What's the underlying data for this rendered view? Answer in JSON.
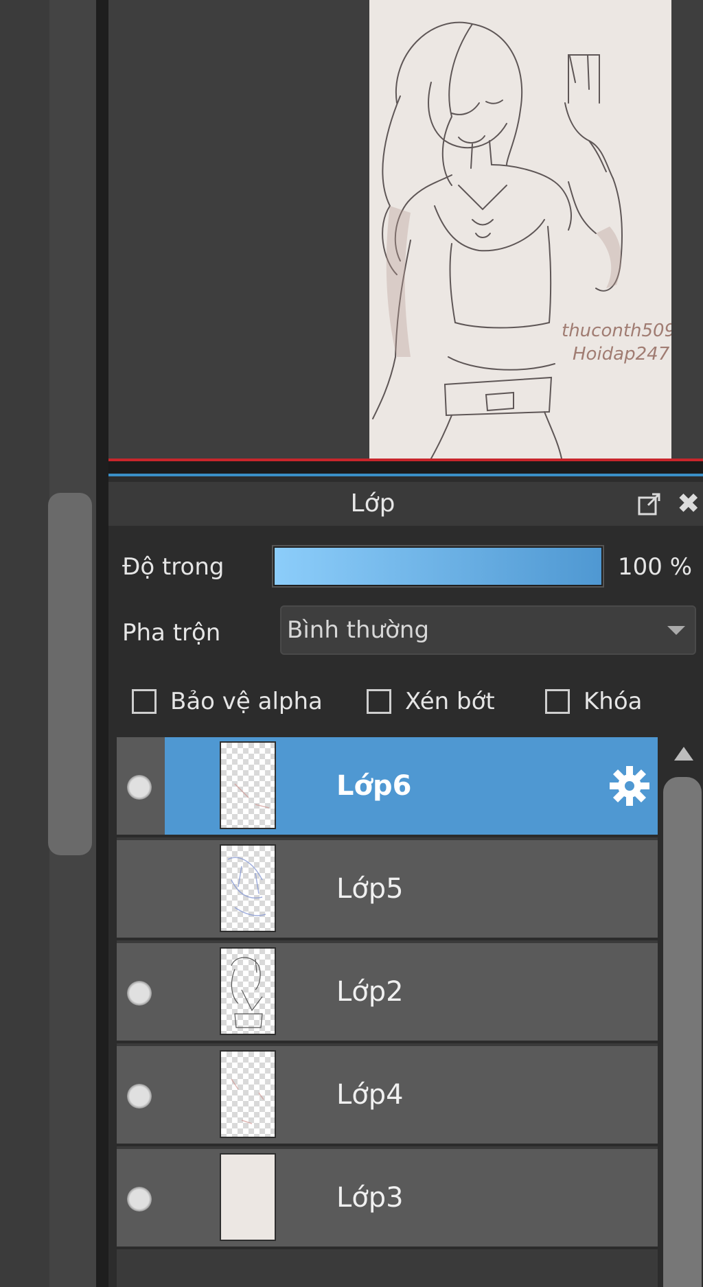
{
  "panel": {
    "title": "Lớp"
  },
  "opacity": {
    "label": "Độ trong",
    "value": 1.0,
    "value_text": "100 %"
  },
  "blend": {
    "label": "Pha trộn",
    "value": "Bình thường"
  },
  "options": {
    "protect_alpha": {
      "label": "Bảo vệ alpha",
      "checked": false
    },
    "clipping": {
      "label": "Xén bớt",
      "checked": false
    },
    "lock": {
      "label": "Khóa",
      "checked": false
    }
  },
  "layers": [
    {
      "name": "Lớp6",
      "visible": true,
      "selected": true,
      "thumb": "transparent-sketch"
    },
    {
      "name": "Lớp5",
      "visible": false,
      "selected": false,
      "thumb": "blue-sketch"
    },
    {
      "name": "Lớp2",
      "visible": true,
      "selected": false,
      "thumb": "lineart"
    },
    {
      "name": "Lớp4",
      "visible": true,
      "selected": false,
      "thumb": "transparent-sketch"
    },
    {
      "name": "Lớp3",
      "visible": true,
      "selected": false,
      "thumb": "paper-fill"
    }
  ],
  "canvas": {
    "signature_line1": "thuconth509",
    "signature_line2": "Hoidap247"
  },
  "colors": {
    "accent": "#4f98d2",
    "selection_bar": "#c8262b",
    "paper": "#ece7e3"
  },
  "icons": [
    "popout-icon",
    "close-icon",
    "gear-icon",
    "visibility-icon",
    "scroll-up-icon"
  ]
}
